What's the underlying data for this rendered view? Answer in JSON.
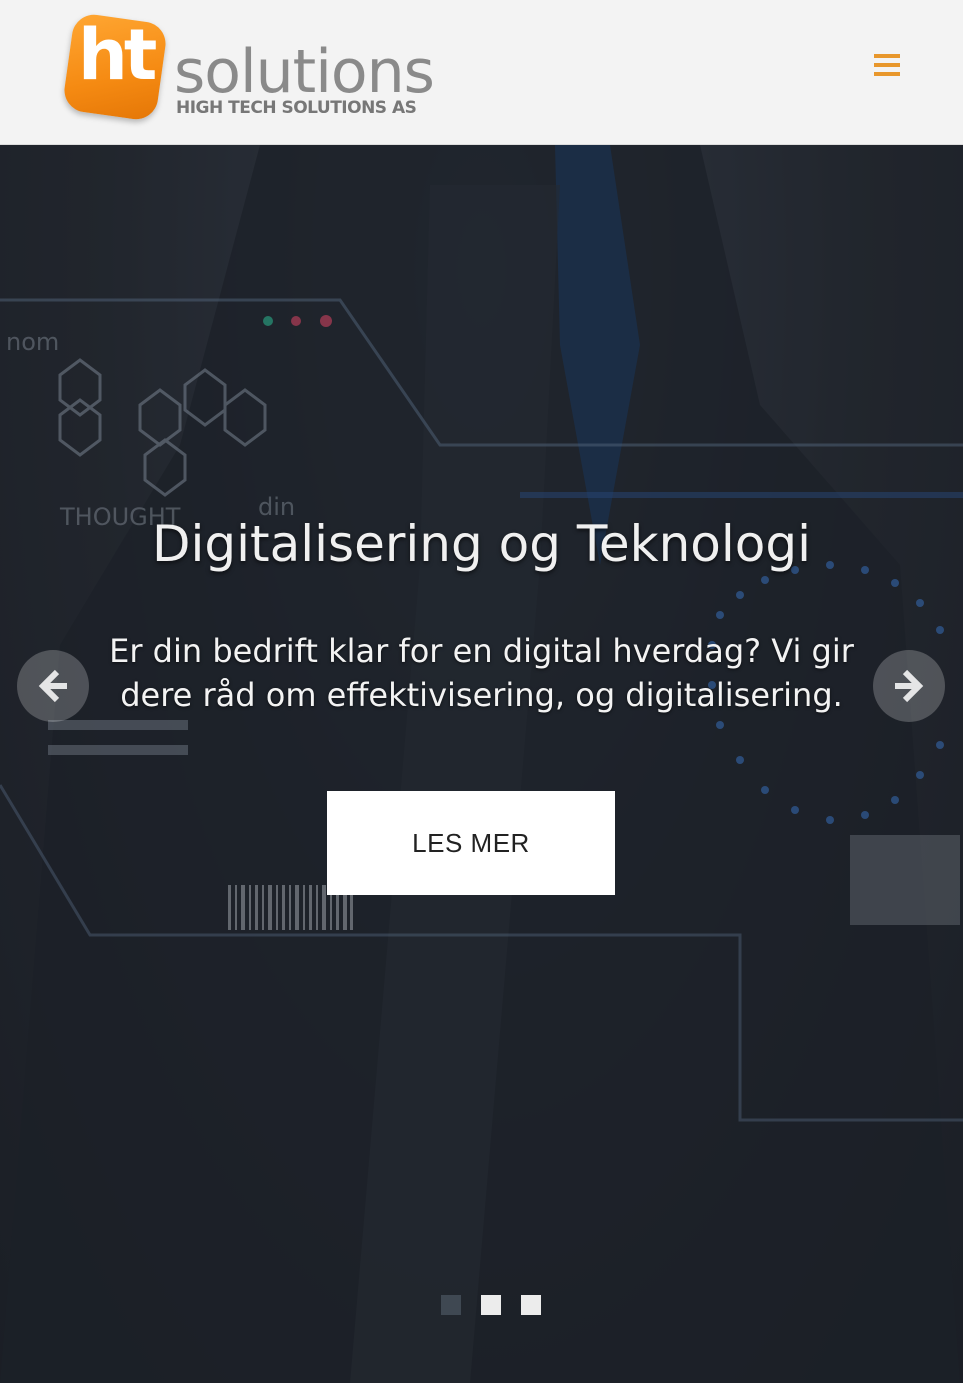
{
  "header": {
    "logo_badge_text": "ht",
    "logo_word": "solutions",
    "logo_tagline": "HIGH TECH SOLUTIONS AS",
    "menu_icon": "hamburger-menu-icon",
    "accent_color": "#e8972c"
  },
  "hero": {
    "title": "Digitalisering og Teknologi",
    "text": "Er din bedrift klar for en digital hverdag? Vi gir dere råd om effektivisering, og digitalisering.",
    "cta_label": "LES MER",
    "prev_icon": "arrow-left-icon",
    "next_icon": "arrow-right-icon",
    "background_decor_text": [
      "nom",
      "THOUGHT",
      "din"
    ],
    "slides": [
      {
        "active": true
      },
      {
        "active": false
      },
      {
        "active": false
      }
    ]
  }
}
